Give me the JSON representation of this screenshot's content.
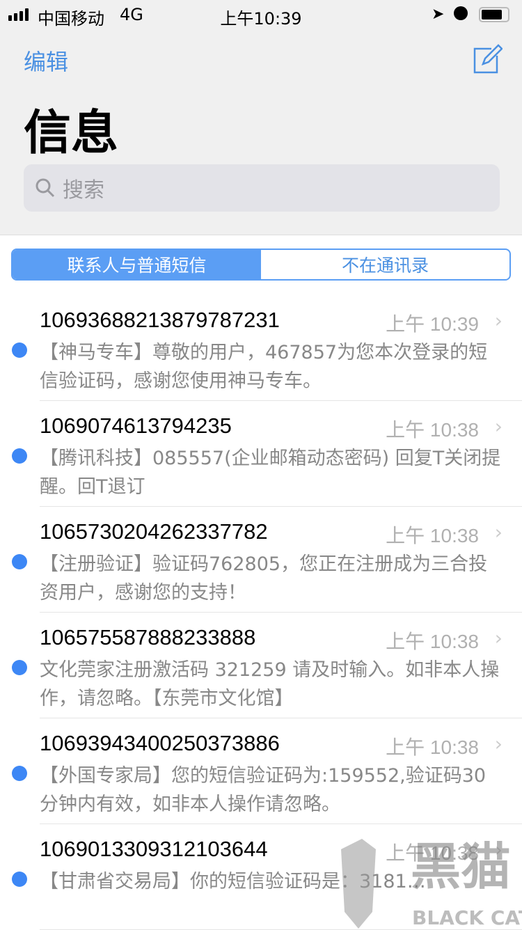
{
  "status": {
    "carrier": "中国移动",
    "network": "4G",
    "time": "上午10:39"
  },
  "nav": {
    "edit": "编辑",
    "title": "信息",
    "search_placeholder": "搜索"
  },
  "segments": [
    {
      "label": "联系人与普通短信",
      "selected": true
    },
    {
      "label": "不在通讯录",
      "selected": false
    }
  ],
  "accent": "#4a90e2",
  "messages": [
    {
      "sender": "106936882138797872​31",
      "time": "上午 10:39",
      "preview": "【神马专车】尊敬的用户，467857为您本次登录的短信验证码，感谢您使用神马专车。",
      "unread": true
    },
    {
      "sender": "1069074613794235",
      "time": "上午 10:38",
      "preview": "【腾讯科技】085557(企业邮箱动态密码) 回复T关闭提醒。回T退订",
      "unread": true
    },
    {
      "sender": "1065730204262337782",
      "time": "上午 10:38",
      "preview": "【注册验证】验证码762805，您正在注册成为三合投资用户，感谢您的支持！",
      "unread": true
    },
    {
      "sender": "1065755878882338​88",
      "time": "上午 10:38",
      "preview": "文化莞家注册激活码 321259 请及时输入。如非本人操作，请忽略。【东莞市文化馆】",
      "unread": true
    },
    {
      "sender": "1069394340025037​3886",
      "time": "上午 10:38",
      "preview": "【外国专家局】您的短信验证码为:159552,验证码30分钟内有效，如非本人操作请忽略。",
      "unread": true
    },
    {
      "sender": "1069013309312103644",
      "time": "上午 10:38",
      "preview": "【甘肃省交易局】你的短信验证码是：3181…",
      "unread": true
    }
  ],
  "watermark": {
    "text": "黑猫",
    "sub": "BLACK CAT"
  }
}
